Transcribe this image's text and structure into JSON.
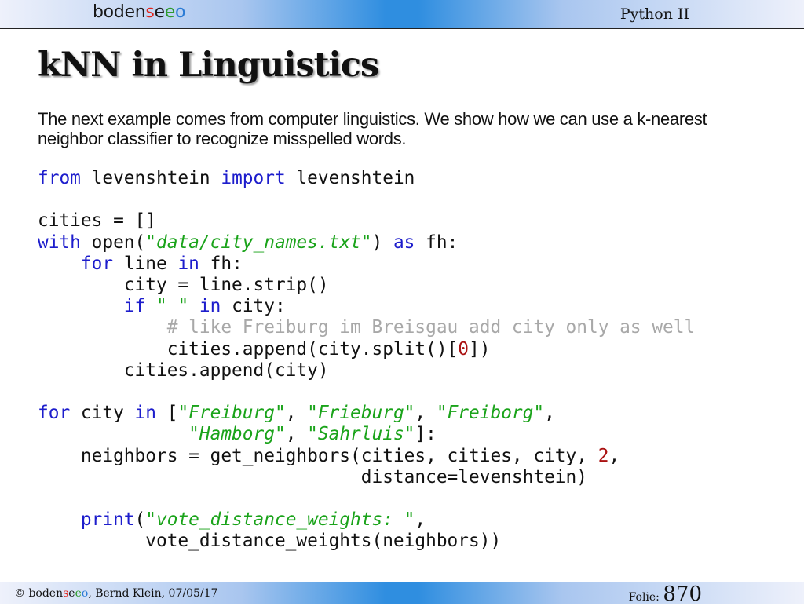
{
  "header": {
    "logo": {
      "p1": "boden",
      "p2": "s",
      "p3": "e",
      "p4": "e",
      "p5": "o"
    },
    "course": "Python II"
  },
  "slide": {
    "title": "kNN in Linguistics",
    "intro": "The next example comes from computer linguistics. We show how we can use a k-nearest neighbor classifier to recognize misspelled words.",
    "code": {
      "l1": {
        "kw1": "from",
        "t1": " levenshtein ",
        "kw2": "import",
        "t2": " levenshtein"
      },
      "l2": {
        "t1": "cities = []"
      },
      "l3": {
        "kw1": "with",
        "t1": " open(",
        "s1": "\"data/city_names.txt\"",
        "t2": ") ",
        "kw2": "as",
        "t3": " fh:"
      },
      "l4": {
        "ind": "    ",
        "kw1": "for",
        "t1": " line ",
        "kw2": "in",
        "t2": " fh:"
      },
      "l5": {
        "ind": "        ",
        "t1": "city = line.strip()"
      },
      "l6": {
        "ind": "        ",
        "kw1": "if",
        "t1": " ",
        "s1": "\" \"",
        "t2": " ",
        "kw2": "in",
        "t3": " city:"
      },
      "l7": {
        "ind": "            ",
        "c1": "# like Freiburg im Breisgau add city only as well"
      },
      "l8": {
        "ind": "            ",
        "t1": "cities.append(city.split()[",
        "n1": "0",
        "t2": "])"
      },
      "l9": {
        "ind": "        ",
        "t1": "cities.append(city)"
      },
      "l10": {
        "kw1": "for",
        "t1": " city ",
        "kw2": "in",
        "t2": " [",
        "s1": "\"Freiburg\"",
        "t3": ", ",
        "s2": "\"Frieburg\"",
        "t4": ", ",
        "s3": "\"Freiborg\"",
        "t5": ","
      },
      "l11": {
        "ind": "              ",
        "s1": "\"Hamborg\"",
        "t1": ", ",
        "s2": "\"Sahrluis\"",
        "t2": "]:"
      },
      "l12": {
        "ind": "    ",
        "t1": "neighbors = get_neighbors(cities, cities, city, ",
        "n1": "2",
        "t2": ","
      },
      "l13": {
        "ind": "                              ",
        "t1": "distance=levenshtein)"
      },
      "l14": {
        "ind": "    ",
        "kw1": "print",
        "t1": "(",
        "s1": "\"vote_distance_weights: \"",
        "t2": ","
      },
      "l15": {
        "ind": "          ",
        "t1": "vote_distance_weights(neighbors))"
      }
    }
  },
  "footer": {
    "copy": "© ",
    "brand": {
      "p1": "boden",
      "p2": "s",
      "p3": "e",
      "p4": "e",
      "p5": "o"
    },
    "rest": ", Bernd Klein, 07/05/17",
    "folio_label": "Folie: ",
    "folio_num": "870"
  },
  "colors": {
    "keyword": "#1d1dcc",
    "string": "#1aa31a",
    "number": "#aa1111",
    "comment": "#a8a8a8",
    "bar_center": "#2f8ee0"
  }
}
